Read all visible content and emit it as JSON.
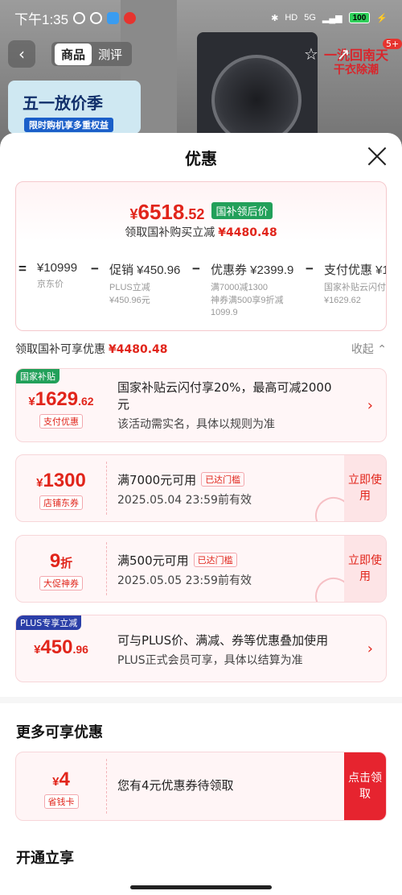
{
  "status": {
    "time": "下午1:35",
    "signal": "5G",
    "battery": "100"
  },
  "background": {
    "promo_title": "五一放价季",
    "promo_sub": "限时购机享多重权益",
    "promo_right_1": "一洗回南天",
    "promo_right_2": "干衣除潮"
  },
  "topnav": {
    "tabs": [
      "商品",
      "测评"
    ],
    "back_icon": "back-arrow-icon",
    "badge": "5+"
  },
  "sheet": {
    "title": "优惠",
    "final": {
      "currency": "¥",
      "integer": "6518",
      "decimal": ".52",
      "tag": "国补领后价",
      "sub_label": "领取国补购买立减",
      "sub_amount": "¥4480.48"
    },
    "calc": {
      "eq": "=",
      "base_price": "¥10999",
      "base_label": "京东价",
      "op1": "−",
      "promo_label": "促销 ¥450.96",
      "promo_s1": "PLUS立减",
      "promo_s2": "¥450.96元",
      "op2": "−",
      "coupon_label": "优惠券 ¥2399.9",
      "coupon_s1": "满7000减1300",
      "coupon_s2": "神券满500享9折减",
      "coupon_s3": "1099.9",
      "op3": "−",
      "pay_label": "支付优惠 ¥1",
      "pay_s1": "国家补贴云闪付",
      "pay_s2": "¥1629.62"
    },
    "discount_header": {
      "label": "领取国补可享优惠",
      "amount": "¥4480.48",
      "collapse": "收起"
    },
    "coupons": [
      {
        "corner": "国家补贴",
        "currency": "¥",
        "amount": "1629",
        "decimal": ".62",
        "type": "支付优惠",
        "line1": "国家补贴云闪付享20%，最高可减2000",
        "line1b": "元",
        "line2": "该活动需实名，具体以规则为准"
      },
      {
        "currency": "¥",
        "amount": "1300",
        "type": "店铺东券",
        "line1": "满7000元可用",
        "threshold": "已达门槛",
        "line2": "2025.05.04 23:59前有效",
        "action": "立即使用"
      },
      {
        "amount": "9",
        "unit": "折",
        "type": "大促神券",
        "line1": "满500元可用",
        "threshold": "已达门槛",
        "line2": "2025.05.05 23:59前有效",
        "action": "立即使用"
      },
      {
        "corner": "PLUS专享立减",
        "currency": "¥",
        "amount": "450",
        "decimal": ".96",
        "line1": "可与PLUS价、满减、券等优惠叠加使用",
        "line2": "PLUS正式会员可享，具体以结算为准"
      }
    ],
    "more_title": "更多可享优惠",
    "more_coupon": {
      "currency": "¥",
      "amount": "4",
      "type": "省钱卡",
      "line1": "您有4元优惠券待领取",
      "action": "点击领取"
    },
    "open_title": "开通立享"
  },
  "colors": {
    "accent": "#e1251b",
    "green_tag": "#22a05a",
    "plus_blue": "#2b3fa8"
  }
}
